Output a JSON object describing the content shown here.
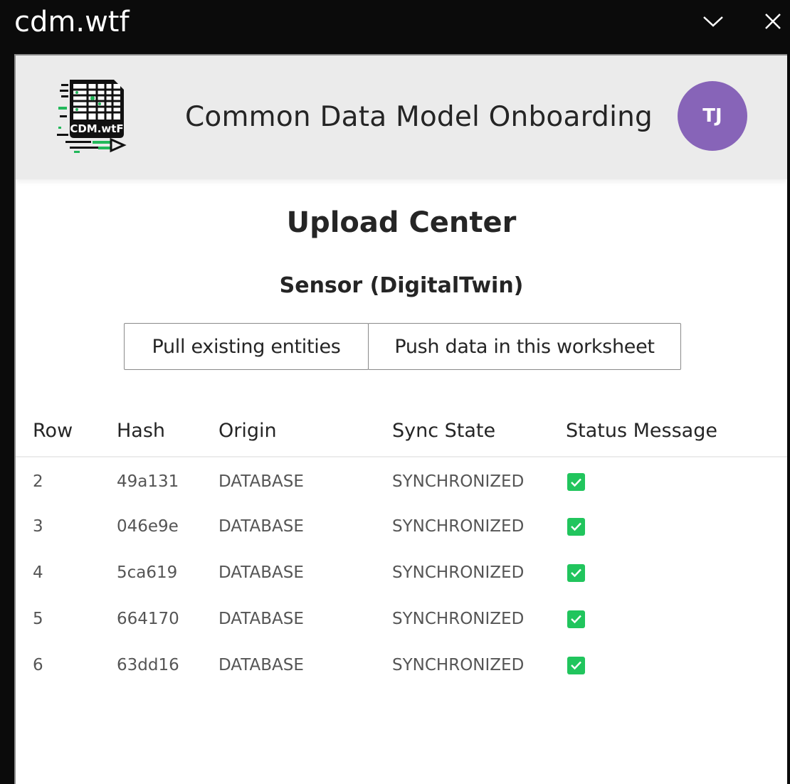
{
  "window": {
    "title": "cdm.wtf",
    "collapse_icon": "chevron-down-icon",
    "close_icon": "close-icon"
  },
  "header": {
    "logo_text": "CDM.wtF",
    "title": "Common Data Model Onboarding",
    "avatar_initials": "TJ",
    "avatar_color": "#8764b8"
  },
  "main": {
    "title": "Upload Center",
    "entity": "Sensor (DigitalTwin)",
    "buttons": {
      "pull": "Pull existing entities",
      "push": "Push data in this worksheet"
    },
    "table": {
      "columns": [
        "Row",
        "Hash",
        "Origin",
        "Sync State",
        "Status Message"
      ],
      "rows": [
        {
          "row": "2",
          "hash": "49a131",
          "origin": "DATABASE",
          "sync_state": "SYNCHRONIZED",
          "status": "check-icon"
        },
        {
          "row": "3",
          "hash": "046e9e",
          "origin": "DATABASE",
          "sync_state": "SYNCHRONIZED",
          "status": "check-icon"
        },
        {
          "row": "4",
          "hash": "5ca619",
          "origin": "DATABASE",
          "sync_state": "SYNCHRONIZED",
          "status": "check-icon"
        },
        {
          "row": "5",
          "hash": "664170",
          "origin": "DATABASE",
          "sync_state": "SYNCHRONIZED",
          "status": "check-icon"
        },
        {
          "row": "6",
          "hash": "63dd16",
          "origin": "DATABASE",
          "sync_state": "SYNCHRONIZED",
          "status": "check-icon"
        }
      ]
    },
    "status_color": "#21c55d"
  }
}
